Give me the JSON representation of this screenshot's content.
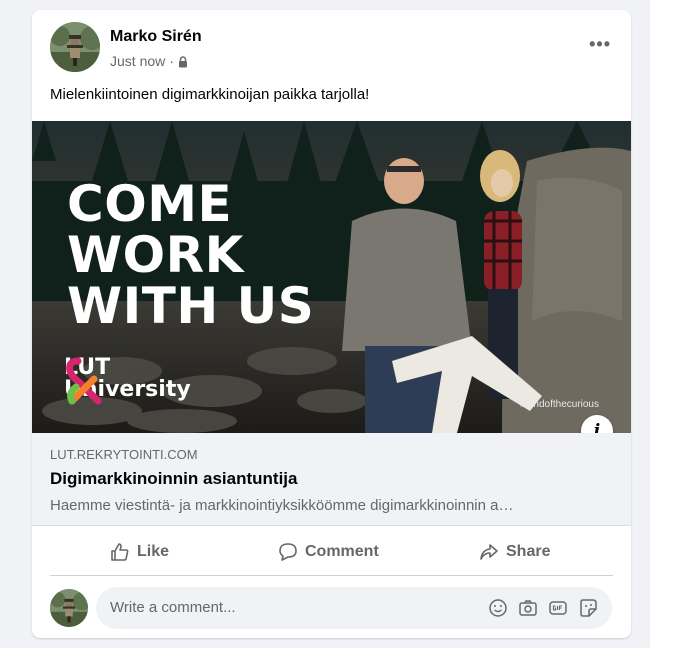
{
  "post": {
    "author": "Marko Sirén",
    "timestamp": "Just now",
    "separator": "·",
    "privacy_icon": "lock-icon",
    "more_label": "•••",
    "message": "Mielenkiintoinen digimarkkinoijan paikka tarjolla!"
  },
  "hero": {
    "headline_line1": "COME",
    "headline_line2": "WORK",
    "headline_line3": "WITH US",
    "logo_line1": "LUT",
    "logo_line2": "University",
    "hashtag": "#landofthecurious",
    "info_label": "i"
  },
  "link": {
    "domain": "LUT.REKRYTOINTI.COM",
    "title": "Digimarkkinoinnin asiantuntija",
    "description": "Haemme viestintä- ja markkinointiyksikköömme digimarkkinoinnin a…"
  },
  "actions": {
    "like": "Like",
    "comment": "Comment",
    "share": "Share"
  },
  "comment_composer": {
    "placeholder": "Write a comment...",
    "icons": [
      "emoji-icon",
      "camera-icon",
      "gif-icon",
      "sticker-icon"
    ]
  },
  "colors": {
    "background": "#f0f2f5",
    "secondary_text": "#65676b",
    "primary_text": "#050505",
    "logo_orange": "#f4812a",
    "logo_magenta": "#d6246e",
    "logo_green": "#6cbf4a"
  }
}
